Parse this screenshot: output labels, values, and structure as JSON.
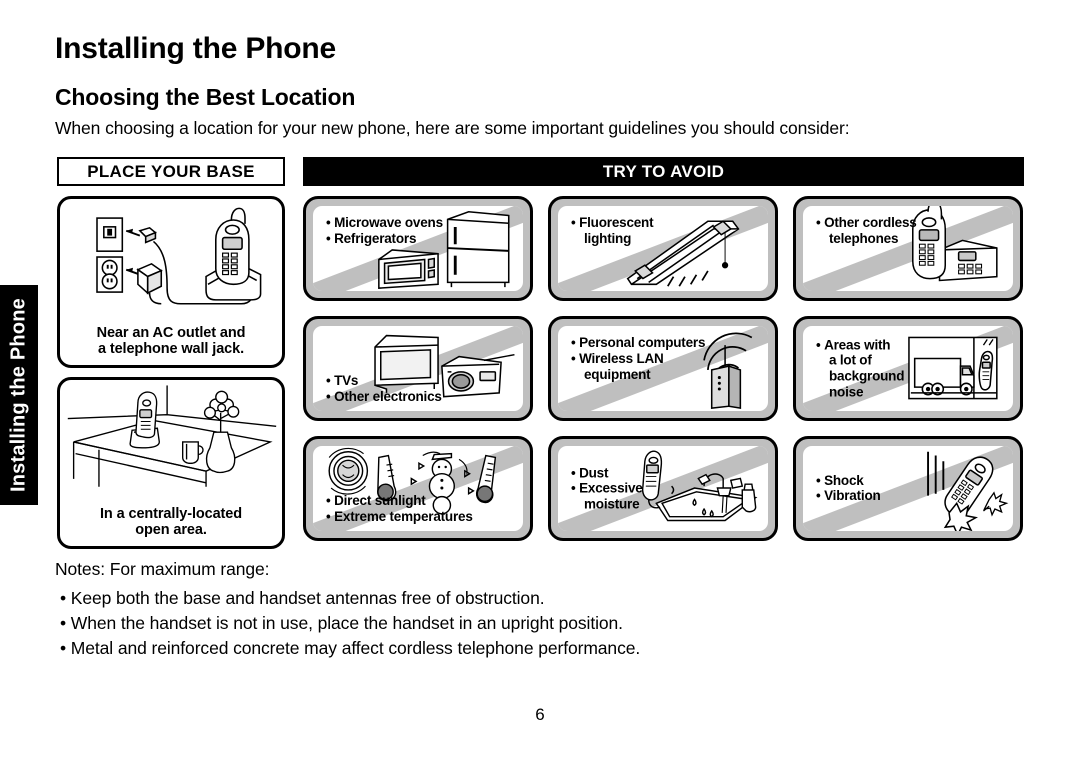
{
  "side_tab": {
    "label": "Installing the Phone"
  },
  "page": {
    "title": "Installing the Phone",
    "section_title": "Choosing the Best Location",
    "intro": "When choosing a location for your new phone, here are some important guidelines you should consider:",
    "page_number": "6"
  },
  "columns": {
    "place_header": "PLACE YOUR BASE",
    "avoid_header": "TRY TO AVOID"
  },
  "place_panels": [
    {
      "caption_line1": "Near an AC outlet and",
      "caption_line2": "a telephone wall jack.",
      "art": "phone-base-wall-jack-illustration"
    },
    {
      "caption_line1": "In a centrally-located",
      "caption_line2": "open area.",
      "art": "phone-on-table-open-area-illustration"
    }
  ],
  "avoid_panels": [
    {
      "art": "microwave-refrigerator-illustration",
      "text_position": "top-left",
      "bullets": [
        {
          "line": "Microwave ovens"
        },
        {
          "line": "Refrigerators"
        }
      ]
    },
    {
      "art": "fluorescent-light-illustration",
      "text_position": "top-left",
      "bullets": [
        {
          "line": "Fluorescent",
          "cont": "lighting"
        }
      ]
    },
    {
      "art": "cordless-telephone-illustration",
      "text_position": "top-left",
      "bullets": [
        {
          "line": "Other cordless",
          "cont": "telephones"
        }
      ]
    },
    {
      "art": "tv-radio-illustration",
      "text_position": "bottom-left",
      "bullets": [
        {
          "line": "TVs"
        },
        {
          "line": "Other electronics"
        }
      ]
    },
    {
      "art": "wireless-lan-router-illustration",
      "text_position": "top-left",
      "bullets": [
        {
          "line": "Personal computers"
        },
        {
          "line": "Wireless LAN",
          "cont": "equipment"
        }
      ]
    },
    {
      "art": "truck-background-noise-illustration",
      "text_position": "mid-left",
      "bullets": [
        {
          "line": "Areas with",
          "cont": "a lot of",
          "cont2": "background",
          "cont3": "noise"
        }
      ]
    },
    {
      "art": "sun-snowman-thermometer-illustration",
      "text_position": "bottom-left",
      "bullets": [
        {
          "line": "Direct sunlight"
        },
        {
          "line": "Extreme temperatures"
        }
      ]
    },
    {
      "art": "sink-water-illustration",
      "text_position": "mid-left",
      "bullets": [
        {
          "line": "Dust"
        },
        {
          "line": "Excessive",
          "cont": "moisture"
        }
      ]
    },
    {
      "art": "dropped-phone-impact-illustration",
      "text_position": "mid-left",
      "bullets": [
        {
          "line": "Shock"
        },
        {
          "line": "Vibration"
        }
      ]
    }
  ],
  "notes": {
    "heading": "Notes: For maximum range:",
    "items": [
      "Keep both the base and handset antennas free of obstruction.",
      "When the handset is not in use, place the handset in an upright position.",
      "Metal and reinforced concrete may affect cordless telephone performance."
    ]
  }
}
